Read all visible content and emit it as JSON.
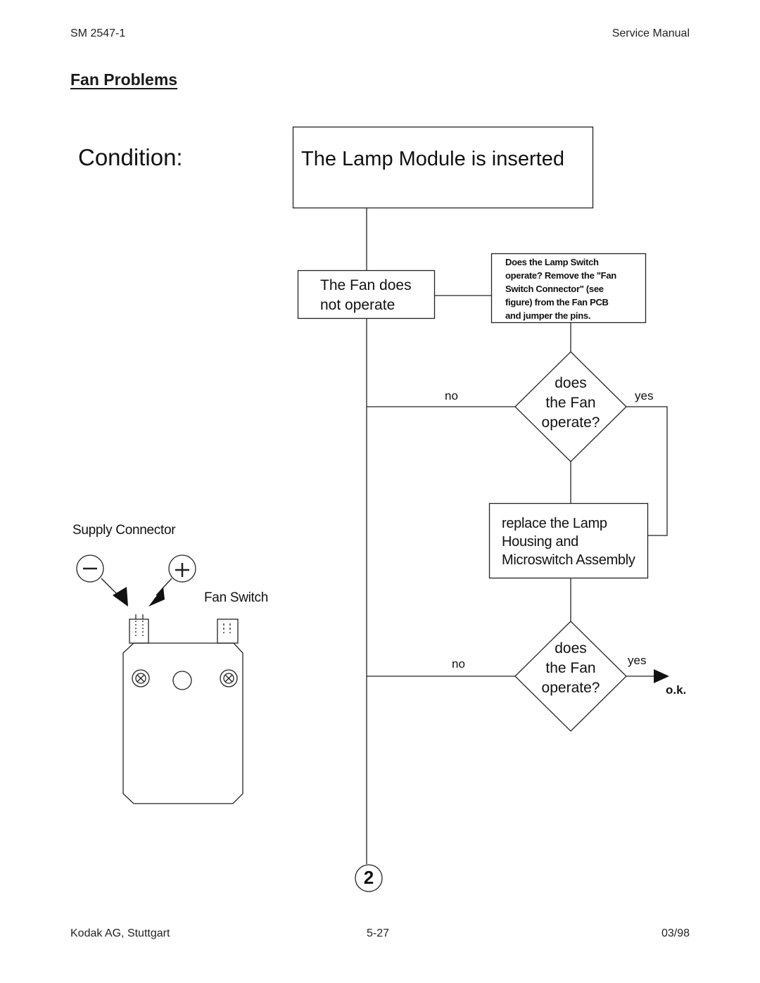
{
  "header": {
    "doc_number": "SM 2547-1",
    "doc_type": "Service Manual"
  },
  "section_title": "Fan Problems",
  "condition_label": "Condition:",
  "flowchart": {
    "start_box": "The Lamp Module is inserted",
    "symptom_box": [
      "The Fan does",
      "not operate"
    ],
    "check_box": [
      "Does the Lamp Switch",
      "operate?  Remove the \"Fan",
      "Switch Connector\" (see",
      "figure) from the Fan PCB",
      "and jumper the pins."
    ],
    "decision_1": {
      "lines": [
        "does",
        "the Fan",
        "operate?"
      ],
      "no_label": "no",
      "yes_label": "yes"
    },
    "action_box": [
      "replace the Lamp",
      "Housing and",
      "Microswitch Assembly"
    ],
    "decision_2": {
      "lines": [
        "does",
        "the Fan",
        "operate?"
      ],
      "no_label": "no",
      "yes_label": "yes"
    },
    "ok_label": "o.k.",
    "connector_label": "2"
  },
  "figure": {
    "supply_connector_label": "Supply Connector",
    "fan_switch_label": "Fan Switch",
    "minus_symbol": "−",
    "plus_symbol": "+"
  },
  "footer": {
    "company": "Kodak AG, Stuttgart",
    "page": "5-27",
    "date": "03/98"
  }
}
